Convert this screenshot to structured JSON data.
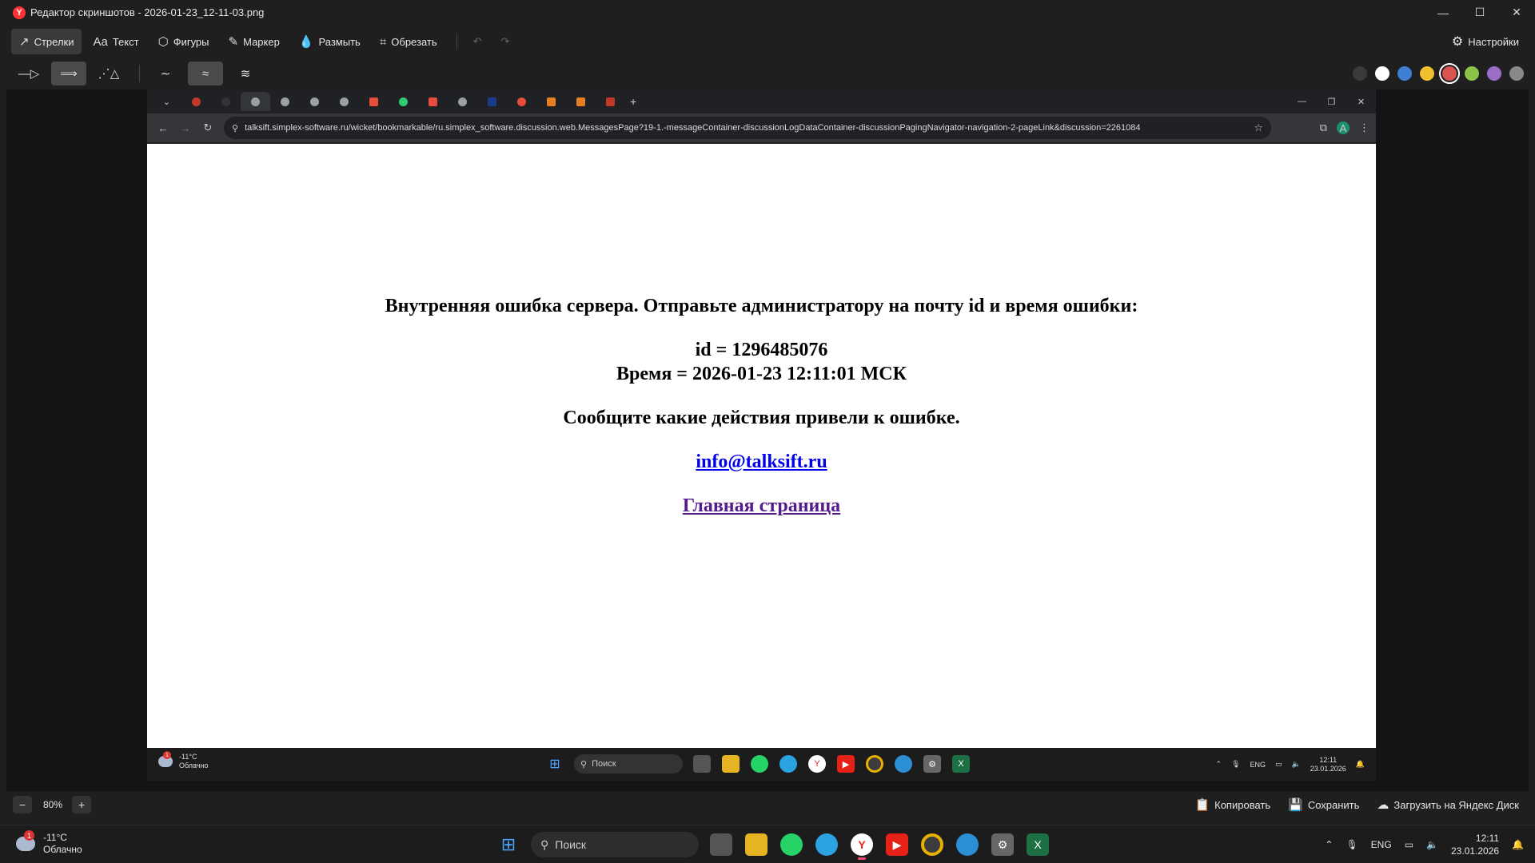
{
  "editor": {
    "title": "Редактор скриншотов - 2026-01-23_12-11-03.png",
    "logo_letter": "Y",
    "tools": [
      {
        "label": "Стрелки",
        "icon": "↗"
      },
      {
        "label": "Текст",
        "icon": "Aa"
      },
      {
        "label": "Фигуры",
        "icon": "⬡"
      },
      {
        "label": "Маркер",
        "icon": "✎"
      },
      {
        "label": "Размыть",
        "icon": "💧"
      },
      {
        "label": "Обрезать",
        "icon": "⌗"
      }
    ],
    "settings_label": "Настройки",
    "palette": [
      "#3a3a3a",
      "#ffffff",
      "#3f7fd4",
      "#f0c030",
      "#d9534f",
      "#8bc34a",
      "#9b6fc8",
      "#888888"
    ],
    "selected_color": "#d9534f",
    "zoom": "80%",
    "zoom_minus": "−",
    "zoom_plus": "+",
    "actions": {
      "copy": "Копировать",
      "save": "Сохранить",
      "upload": "Загрузить на Яндекс Диск"
    }
  },
  "browser": {
    "url": "talksift.simplex-software.ru/wicket/bookmarkable/ru.simplex_software.discussion.web.MessagesPage?19-1.-messageContainer-discussionLogDataContainer-discussionPagingNavigator-navigation-2-pageLink&discussion=2261084",
    "avatar": "A"
  },
  "page": {
    "error_title": "Внутренняя ошибка сервера. Отправьте администратору на почту id и время ошибки:",
    "id_line": "id = 1296485076",
    "time_line": "Время = 2026-01-23 12:11:01 МСК",
    "report_line": "Сообщите какие действия привели к ошибке.",
    "email": "info@talksift.ru",
    "home_link": "Главная страница"
  },
  "screenshot_taskbar": {
    "temp": "-11°C",
    "weather": "Облачно",
    "badge": "1",
    "search": "Поиск",
    "lang": "ENG",
    "time": "12:11",
    "date": "23.01.2026"
  },
  "taskbar": {
    "temp": "-11°C",
    "weather": "Облачно",
    "badge": "1",
    "search": "Поиск",
    "lang": "ENG",
    "time": "12:11",
    "date": "23.01.2026"
  }
}
